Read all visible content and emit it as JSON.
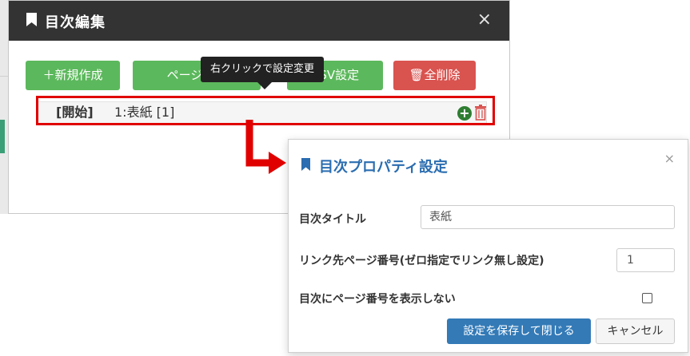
{
  "toc_dialog": {
    "title": "目次編集",
    "close_glyph": "×",
    "buttons": {
      "new": "＋新規作成",
      "page_start": "ページ開始",
      "csv": "CSV設定",
      "delete_all": "🗑全削除"
    },
    "tooltip": "右クリックで設定変更",
    "row": {
      "tag": "[開始]",
      "text": "1:表紙 [1]"
    }
  },
  "properties_dialog": {
    "title": "目次プロパティ設定",
    "close_glyph": "×",
    "title_label": "目次タイトル",
    "title_value": "表紙",
    "link_label": "リンク先ページ番号(ゼロ指定でリンク無し設定)",
    "link_value": "1",
    "hide_page_label": "目次にページ番号を表示しない",
    "hide_page_checked": false,
    "save_button": "設定を保存して閉じる",
    "cancel_button": "キャンセル"
  },
  "colors": {
    "header_bg": "#333333",
    "green": "#5cb85c",
    "red": "#d9534f",
    "primary": "#337ab7",
    "highlight": "#e00000",
    "title_blue": "#2a6db0"
  }
}
